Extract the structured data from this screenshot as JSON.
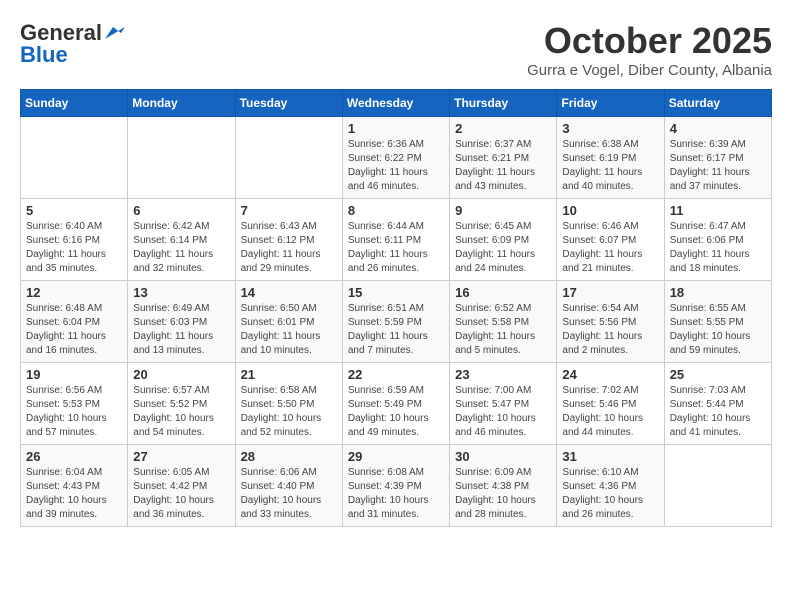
{
  "header": {
    "logo_general": "General",
    "logo_blue": "Blue",
    "month": "October 2025",
    "location": "Gurra e Vogel, Diber County, Albania"
  },
  "days_of_week": [
    "Sunday",
    "Monday",
    "Tuesday",
    "Wednesday",
    "Thursday",
    "Friday",
    "Saturday"
  ],
  "weeks": [
    [
      {
        "day": "",
        "info": ""
      },
      {
        "day": "",
        "info": ""
      },
      {
        "day": "",
        "info": ""
      },
      {
        "day": "1",
        "info": "Sunrise: 6:36 AM\nSunset: 6:22 PM\nDaylight: 11 hours\nand 46 minutes."
      },
      {
        "day": "2",
        "info": "Sunrise: 6:37 AM\nSunset: 6:21 PM\nDaylight: 11 hours\nand 43 minutes."
      },
      {
        "day": "3",
        "info": "Sunrise: 6:38 AM\nSunset: 6:19 PM\nDaylight: 11 hours\nand 40 minutes."
      },
      {
        "day": "4",
        "info": "Sunrise: 6:39 AM\nSunset: 6:17 PM\nDaylight: 11 hours\nand 37 minutes."
      }
    ],
    [
      {
        "day": "5",
        "info": "Sunrise: 6:40 AM\nSunset: 6:16 PM\nDaylight: 11 hours\nand 35 minutes."
      },
      {
        "day": "6",
        "info": "Sunrise: 6:42 AM\nSunset: 6:14 PM\nDaylight: 11 hours\nand 32 minutes."
      },
      {
        "day": "7",
        "info": "Sunrise: 6:43 AM\nSunset: 6:12 PM\nDaylight: 11 hours\nand 29 minutes."
      },
      {
        "day": "8",
        "info": "Sunrise: 6:44 AM\nSunset: 6:11 PM\nDaylight: 11 hours\nand 26 minutes."
      },
      {
        "day": "9",
        "info": "Sunrise: 6:45 AM\nSunset: 6:09 PM\nDaylight: 11 hours\nand 24 minutes."
      },
      {
        "day": "10",
        "info": "Sunrise: 6:46 AM\nSunset: 6:07 PM\nDaylight: 11 hours\nand 21 minutes."
      },
      {
        "day": "11",
        "info": "Sunrise: 6:47 AM\nSunset: 6:06 PM\nDaylight: 11 hours\nand 18 minutes."
      }
    ],
    [
      {
        "day": "12",
        "info": "Sunrise: 6:48 AM\nSunset: 6:04 PM\nDaylight: 11 hours\nand 16 minutes."
      },
      {
        "day": "13",
        "info": "Sunrise: 6:49 AM\nSunset: 6:03 PM\nDaylight: 11 hours\nand 13 minutes."
      },
      {
        "day": "14",
        "info": "Sunrise: 6:50 AM\nSunset: 6:01 PM\nDaylight: 11 hours\nand 10 minutes."
      },
      {
        "day": "15",
        "info": "Sunrise: 6:51 AM\nSunset: 5:59 PM\nDaylight: 11 hours\nand 7 minutes."
      },
      {
        "day": "16",
        "info": "Sunrise: 6:52 AM\nSunset: 5:58 PM\nDaylight: 11 hours\nand 5 minutes."
      },
      {
        "day": "17",
        "info": "Sunrise: 6:54 AM\nSunset: 5:56 PM\nDaylight: 11 hours\nand 2 minutes."
      },
      {
        "day": "18",
        "info": "Sunrise: 6:55 AM\nSunset: 5:55 PM\nDaylight: 10 hours\nand 59 minutes."
      }
    ],
    [
      {
        "day": "19",
        "info": "Sunrise: 6:56 AM\nSunset: 5:53 PM\nDaylight: 10 hours\nand 57 minutes."
      },
      {
        "day": "20",
        "info": "Sunrise: 6:57 AM\nSunset: 5:52 PM\nDaylight: 10 hours\nand 54 minutes."
      },
      {
        "day": "21",
        "info": "Sunrise: 6:58 AM\nSunset: 5:50 PM\nDaylight: 10 hours\nand 52 minutes."
      },
      {
        "day": "22",
        "info": "Sunrise: 6:59 AM\nSunset: 5:49 PM\nDaylight: 10 hours\nand 49 minutes."
      },
      {
        "day": "23",
        "info": "Sunrise: 7:00 AM\nSunset: 5:47 PM\nDaylight: 10 hours\nand 46 minutes."
      },
      {
        "day": "24",
        "info": "Sunrise: 7:02 AM\nSunset: 5:46 PM\nDaylight: 10 hours\nand 44 minutes."
      },
      {
        "day": "25",
        "info": "Sunrise: 7:03 AM\nSunset: 5:44 PM\nDaylight: 10 hours\nand 41 minutes."
      }
    ],
    [
      {
        "day": "26",
        "info": "Sunrise: 6:04 AM\nSunset: 4:43 PM\nDaylight: 10 hours\nand 39 minutes."
      },
      {
        "day": "27",
        "info": "Sunrise: 6:05 AM\nSunset: 4:42 PM\nDaylight: 10 hours\nand 36 minutes."
      },
      {
        "day": "28",
        "info": "Sunrise: 6:06 AM\nSunset: 4:40 PM\nDaylight: 10 hours\nand 33 minutes."
      },
      {
        "day": "29",
        "info": "Sunrise: 6:08 AM\nSunset: 4:39 PM\nDaylight: 10 hours\nand 31 minutes."
      },
      {
        "day": "30",
        "info": "Sunrise: 6:09 AM\nSunset: 4:38 PM\nDaylight: 10 hours\nand 28 minutes."
      },
      {
        "day": "31",
        "info": "Sunrise: 6:10 AM\nSunset: 4:36 PM\nDaylight: 10 hours\nand 26 minutes."
      },
      {
        "day": "",
        "info": ""
      }
    ]
  ]
}
